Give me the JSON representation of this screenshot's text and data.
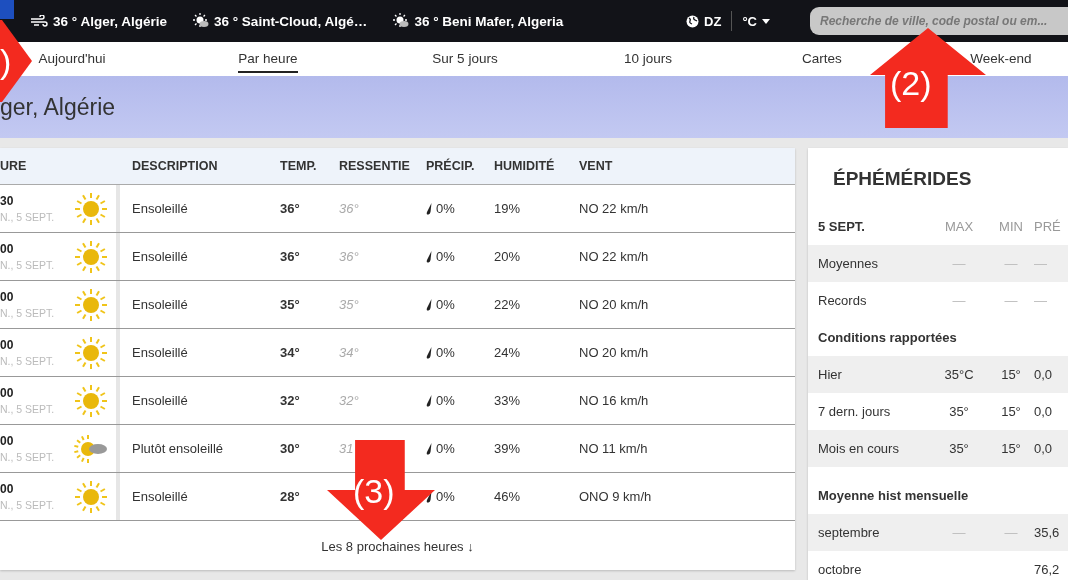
{
  "top_bar": {
    "locations": [
      {
        "kind": "wind",
        "text": "36 ° Alger, Algérie"
      },
      {
        "kind": "sun-cloud",
        "text": "36 ° Saint-Cloud, Algé…"
      },
      {
        "kind": "sun-cloud",
        "text": "36 ° Beni Mafer, Algeria"
      }
    ],
    "region": "DZ",
    "unit": "°C",
    "search": {
      "placeholder": "Recherche de ville, code postal ou em..."
    }
  },
  "tabs": [
    {
      "label": "Aujourd'hui",
      "selected": false
    },
    {
      "label": "Par heure",
      "selected": true
    },
    {
      "label": "Sur 5 jours",
      "selected": false
    },
    {
      "label": "10 jours",
      "selected": false
    },
    {
      "label": "Cartes",
      "selected": false
    },
    {
      "label": "Week-end",
      "selected": false
    }
  ],
  "page_title": "ger, Algérie",
  "hourly_table": {
    "columns": [
      "URE",
      "DESCRIPTION",
      "TEMP.",
      "RESSENTIE",
      "PRÉCIP.",
      "HUMIDITÉ",
      "VENT"
    ],
    "rows": [
      {
        "time": "30",
        "date": "N., 5 SEPT.",
        "kind": "sunny",
        "description": "Ensoleillé",
        "temp": "36°",
        "feels": "36°",
        "precip": "0%",
        "humidity": "19%",
        "wind": "NO 22 km/h"
      },
      {
        "time": "00",
        "date": "N., 5 SEPT.",
        "kind": "sunny",
        "description": "Ensoleillé",
        "temp": "36°",
        "feels": "36°",
        "precip": "0%",
        "humidity": "20%",
        "wind": "NO 22 km/h"
      },
      {
        "time": "00",
        "date": "N., 5 SEPT.",
        "kind": "sunny",
        "description": "Ensoleillé",
        "temp": "35°",
        "feels": "35°",
        "precip": "0%",
        "humidity": "22%",
        "wind": "NO 20 km/h"
      },
      {
        "time": "00",
        "date": "N., 5 SEPT.",
        "kind": "sunny",
        "description": "Ensoleillé",
        "temp": "34°",
        "feels": "34°",
        "precip": "0%",
        "humidity": "24%",
        "wind": "NO 20 km/h"
      },
      {
        "time": "00",
        "date": "N., 5 SEPT.",
        "kind": "sunny",
        "description": "Ensoleillé",
        "temp": "32°",
        "feels": "32°",
        "precip": "0%",
        "humidity": "33%",
        "wind": "NO 16 km/h"
      },
      {
        "time": "00",
        "date": "N., 5 SEPT.",
        "kind": "partly-sunny",
        "description": "Plutôt ensoleillé",
        "temp": "30°",
        "feels": "31",
        "precip": "0%",
        "humidity": "39%",
        "wind": "NO 11 km/h"
      },
      {
        "time": "00",
        "date": "N., 5 SEPT.",
        "kind": "sunny",
        "description": "Ensoleillé",
        "temp": "28°",
        "precip": "0%",
        "humidity": "46%",
        "wind": "ONO 9 km/h"
      }
    ],
    "more_link": "Les 8 prochaines heures ↓"
  },
  "ephemerides": {
    "title": "ÉPHÉMÉRIDES",
    "rows": [
      {
        "kind": "header",
        "cells": [
          "5 SEPT.",
          "MAX",
          "MIN",
          "PRÉ"
        ]
      },
      {
        "kind": "row",
        "cells": [
          "Moyennes",
          "—",
          "—",
          "—"
        ]
      },
      {
        "kind": "row",
        "cells": [
          "Records",
          "—",
          "—",
          "—"
        ]
      },
      {
        "kind": "section",
        "cells": [
          "Conditions rapportées"
        ]
      },
      {
        "kind": "row",
        "cells": [
          "Hier",
          "35°C",
          "15°",
          "0,0"
        ]
      },
      {
        "kind": "row",
        "cells": [
          "7 dern. jours",
          "35°",
          "15°",
          "0,0"
        ]
      },
      {
        "kind": "row",
        "cells": [
          "Mois en cours",
          "35°",
          "15°",
          "0,0"
        ]
      },
      {
        "kind": "section",
        "cells": [
          "Moyenne hist mensuelle"
        ]
      },
      {
        "kind": "row",
        "cells": [
          "septembre",
          "—",
          "—",
          "35,6"
        ]
      },
      {
        "kind": "row",
        "cells": [
          "octobre",
          "",
          "",
          "76,2"
        ]
      }
    ]
  },
  "annotations": [
    {
      "kind": "right",
      "label": ")"
    },
    {
      "kind": "up",
      "label": "(2)"
    },
    {
      "kind": "down",
      "label": "(3)"
    }
  ]
}
